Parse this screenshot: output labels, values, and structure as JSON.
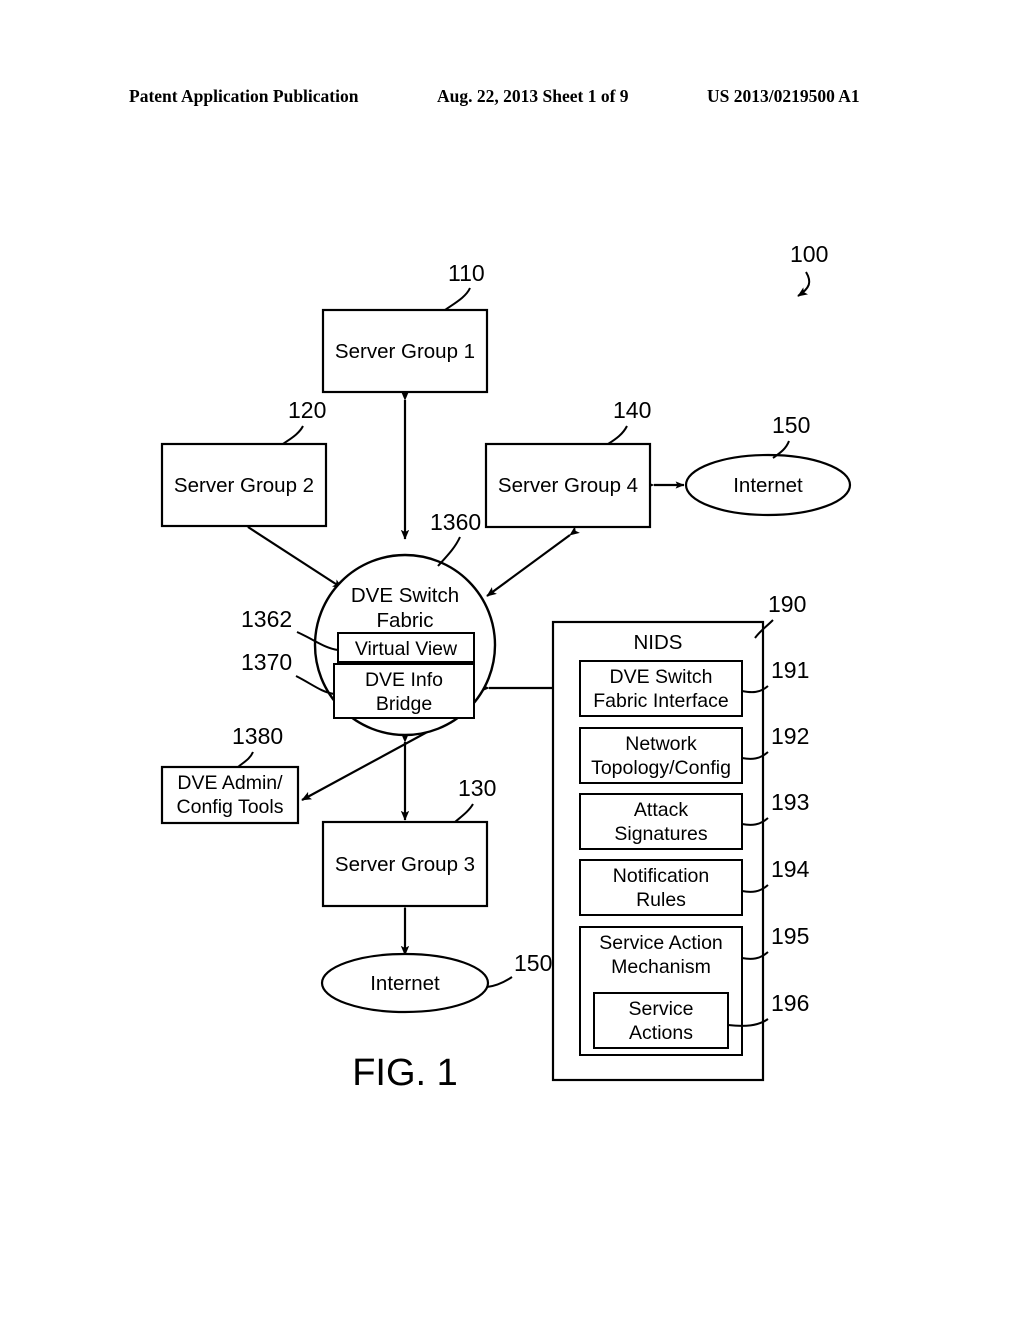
{
  "header": {
    "publication": "Patent Application Publication",
    "date_sheet": "Aug. 22, 2013  Sheet 1 of 9",
    "patent_number": "US 2013/0219500 A1"
  },
  "figure": {
    "caption": "FIG. 1",
    "system_ref": "100"
  },
  "nodes": {
    "server_group_1": {
      "label": "Server Group 1",
      "ref": "110"
    },
    "server_group_2": {
      "label": "Server Group 2",
      "ref": "120"
    },
    "server_group_3": {
      "label": "Server Group 3",
      "ref": "130"
    },
    "server_group_4": {
      "label": "Server Group 4",
      "ref": "140"
    },
    "internet_top": {
      "label": "Internet",
      "ref": "150"
    },
    "internet_bottom": {
      "label": "Internet",
      "ref": "150"
    },
    "dve_switch_fabric": {
      "label_line1": "DVE Switch",
      "label_line2": "Fabric",
      "ref": "1360"
    },
    "virtual_view": {
      "label": "Virtual View",
      "ref": "1362"
    },
    "dve_info_bridge": {
      "label_line1": "DVE Info",
      "label_line2": "Bridge",
      "ref": "1370"
    },
    "dve_admin_config_tools": {
      "label_line1": "DVE Admin/",
      "label_line2": "Config Tools",
      "ref": "1380"
    }
  },
  "nids": {
    "title": "NIDS",
    "ref": "190",
    "components": [
      {
        "label_line1": "DVE Switch",
        "label_line2": "Fabric Interface",
        "ref": "191"
      },
      {
        "label_line1": "Network",
        "label_line2": "Topology/Config",
        "ref": "192"
      },
      {
        "label_line1": "Attack",
        "label_line2": "Signatures",
        "ref": "193"
      },
      {
        "label_line1": "Notification",
        "label_line2": "Rules",
        "ref": "194"
      },
      {
        "label_line1": "Service Action",
        "label_line2": "Mechanism",
        "ref": "195"
      }
    ],
    "service_actions": {
      "label_line1": "Service",
      "label_line2": "Actions",
      "ref": "196"
    }
  }
}
